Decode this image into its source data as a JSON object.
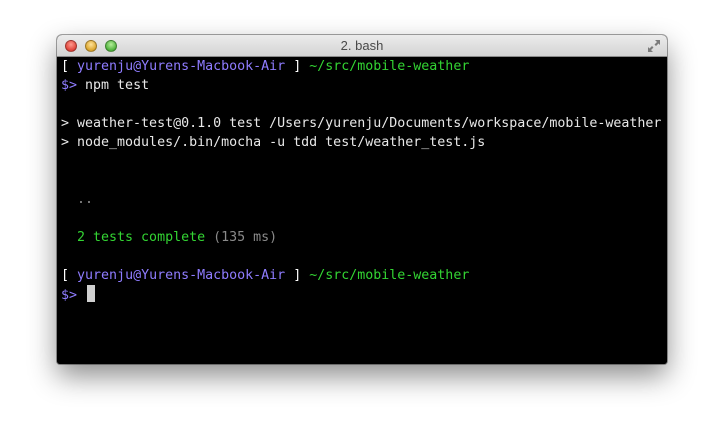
{
  "window": {
    "title": "2. bash"
  },
  "terminal": {
    "prompt1": {
      "open_bracket": "[",
      "user_host": "yurenju@Yurens-Macbook-Air",
      "close_bracket": "]",
      "path": "~/src/mobile-weather"
    },
    "command_line": {
      "prompt_symbol": "$>",
      "command": "npm test"
    },
    "output_line1": "> weather-test@0.1.0 test /Users/yurenju/Documents/workspace/mobile-weather",
    "output_line2": "> node_modules/.bin/mocha -u tdd test/weather_test.js",
    "dots": "  ..",
    "result": {
      "summary": "  2 tests complete",
      "timing": " (135 ms)"
    },
    "prompt2": {
      "open_bracket": "[",
      "user_host": "yurenju@Yurens-Macbook-Air",
      "close_bracket": "]",
      "path": "~/src/mobile-weather"
    },
    "current_line": {
      "prompt_symbol": "$>"
    }
  },
  "colors": {
    "background": "#000000",
    "prompt_user": "#8f7cff",
    "path_green": "#33d433",
    "text": "#e8e8e8",
    "timing_gray": "#8a8a8a"
  },
  "icons": {
    "close": "close-icon",
    "minimize": "minimize-icon",
    "zoom": "zoom-icon",
    "fullscreen": "fullscreen-icon"
  }
}
